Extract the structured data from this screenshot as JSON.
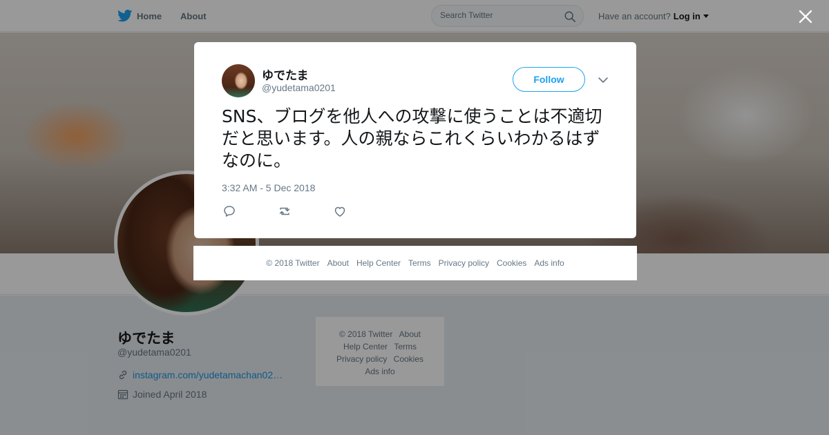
{
  "topnav": {
    "home_label": "Home",
    "about_label": "About",
    "search_placeholder": "Search Twitter",
    "account_prompt": "Have an account?",
    "login_label": "Log in"
  },
  "profile": {
    "name": "ゆでたま",
    "handle": "@yudetama0201",
    "link": "instagram.com/yudetamachan02…",
    "joined": "Joined April 2018"
  },
  "side_footer": {
    "items": [
      "© 2018 Twitter",
      "About",
      "Help Center",
      "Terms",
      "Privacy policy",
      "Cookies",
      "Ads info"
    ]
  },
  "tweet": {
    "author_name": "ゆでたま",
    "author_handle": "@yudetama0201",
    "follow_label": "Follow",
    "text": "SNS、ブログを他人への攻撃に使うことは不適切だと思います。人の親ならこれくらいわかるはずなのに。",
    "timestamp": "3:32 AM - 5 Dec 2018"
  },
  "modal_footer": {
    "items": [
      "© 2018 Twitter",
      "About",
      "Help Center",
      "Terms",
      "Privacy policy",
      "Cookies",
      "Ads info"
    ]
  },
  "colors": {
    "accent": "#1da1f2",
    "link": "#1b95e0",
    "secondary_text": "#657786"
  }
}
